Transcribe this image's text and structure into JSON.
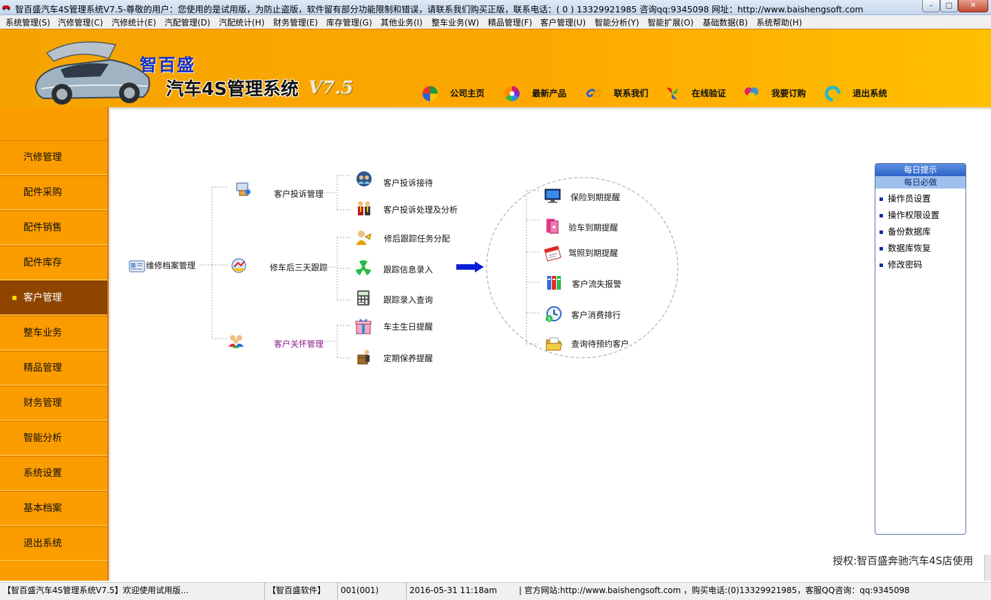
{
  "window": {
    "title": "智百盛汽车4S管理系统V7.5-尊敬的用户：您使用的是试用版，为防止盗版，软件留有部分功能限制和错误，请联系我们购买正版，联系电话：( 0 ) 13329921985  咨询qq:9345098   网址：http://www.baishengsoft.com",
    "minimize": "–",
    "maximize": "□",
    "close": "✕"
  },
  "menu": [
    "系统管理(S)",
    "汽修管理(C)",
    "汽修统计(E)",
    "汽配管理(D)",
    "汽配统计(H)",
    "财务管理(E)",
    "库存管理(G)",
    "其他业务(I)",
    "整车业务(W)",
    "精品管理(F)",
    "客户管理(U)",
    "智能分析(Y)",
    "智能扩展(O)",
    "基础数据(B)",
    "系统帮助(H)"
  ],
  "header": {
    "brand": "智百盛",
    "product": "汽车4S管理系统",
    "version": "V7.5",
    "nav": [
      {
        "label": "公司主页",
        "icon": "pie-icon"
      },
      {
        "label": "最新产品",
        "icon": "color-wheel-icon"
      },
      {
        "label": "联系我们",
        "icon": "link-icon"
      },
      {
        "label": "在线验证",
        "icon": "pinwheel-icon"
      },
      {
        "label": "我要订购",
        "icon": "color-bubble-icon"
      },
      {
        "label": "退出系统",
        "icon": "power-ring-icon"
      }
    ]
  },
  "sidebar": {
    "items": [
      "汽修管理",
      "配件采购",
      "配件销售",
      "配件库存",
      "客户管理",
      "整车业务",
      "精品管理",
      "财务管理",
      "智能分析",
      "系统设置",
      "基本档案",
      "退出系统"
    ],
    "active_index": 4
  },
  "flow": {
    "root": "维修档案管理",
    "groups": [
      {
        "label": "客户投诉管理",
        "children": [
          "客户投诉接待",
          "客户投诉处理及分析"
        ]
      },
      {
        "label": "修车后三天跟踪",
        "children": [
          "修后跟踪任务分配",
          "跟踪信息录入",
          "跟踪录入查询"
        ]
      },
      {
        "label": "客户关怀管理",
        "children": [
          "车主生日提醒",
          "定期保养提醒"
        ]
      }
    ],
    "circle_items": [
      "保险到期提醒",
      "验车到期提醒",
      "驾照到期提醒",
      "客户流失报警",
      "客户消费排行",
      "查询待预约客户"
    ]
  },
  "tips": {
    "title": "每日提示",
    "subtitle": "每日必做",
    "items": [
      "操作员设置",
      "操作权限设置",
      "备份数据库",
      "数据库恢复",
      "修改密码"
    ]
  },
  "license": "授权:智百盛奔驰汽车4S店使用",
  "status": {
    "app": "【智百盛汽车4S管理系统V7.5】欢迎使用试用版...",
    "company": "【智百盛软件】",
    "user": "001(001)",
    "datetime": "2016-05-31 11:18am",
    "contact": "| 官方网站:http://www.baishengsoft.com ，购买电话:(0)13329921985，客服QQ咨询：qq:9345098"
  },
  "colors": {
    "header_orange": "#fda800",
    "sidebar_orange": "#fb9c00",
    "sidebar_active": "#8f4500",
    "brand_blue": "#1530c8",
    "arrow_blue": "#0a1ed8",
    "care_purple": "#8a1a8a"
  }
}
